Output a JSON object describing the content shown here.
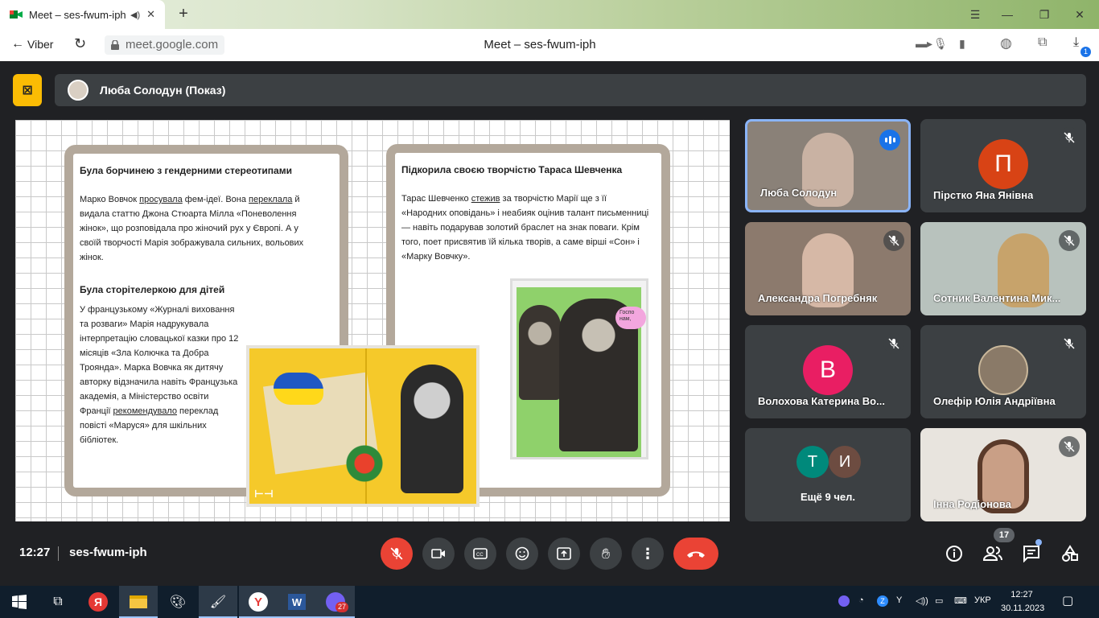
{
  "browser": {
    "tab_title": "Meet – ses-fwum-iph",
    "back_label": "Viber",
    "url": "meet.google.com",
    "page_title": "Meet – ses-fwum-iph",
    "download_badge": "1"
  },
  "meet": {
    "presenter_label": "Люба Солодун (Показ)",
    "time": "12:27",
    "meeting_code": "ses-fwum-iph",
    "participants_count": "17"
  },
  "slide": {
    "card1": {
      "heading1": "Була борчинею з гендерними стереотипами",
      "para1_parts": [
        "Марко Вовчок ",
        "просувала",
        " фем-ідеї. Вона ",
        "переклала",
        " й видала статтю Джона Стюарта Мілла «Поневолення жінок», що розповідала про жіночий рух у Європі. А у своїй творчості Марія зображувала сильних, вольових жінок."
      ],
      "heading2": "Була сторітелеркою для дітей",
      "para2_parts": [
        "У французькому «Журналі виховання та розваги» Марія надрукувала інтерпретацію словацької казки про 12 місяців «Зла Колючка та Добра Троянда». Марка Вовчка як дитячу авторку відзначила навіть Французька академія, а Міністерство освіти Франції ",
        "рекомендувало",
        " переклад повісті «Маруся» для шкільних бібліотек."
      ]
    },
    "card2": {
      "heading": "Підкорила своєю творчістю Тараса Шевченка",
      "para_parts": [
        "Тарас Шевченко ",
        "стежив",
        " за творчістю Марії ще з її «Народних оповідань» і неабияк оцінив талант письменниці — навіть подарував золотий браслет на знак поваги. Крім того, поет присвятив їй кілька творів, а саме вірші «Сон» і «Марку Вовчку»."
      ]
    },
    "poster_bubble": "Госпо нам,"
  },
  "tiles": [
    {
      "name": "Люба Солодун",
      "type": "video",
      "speaking": true
    },
    {
      "name": "Пірстко Яна Янівна",
      "type": "avatar",
      "initial": "П",
      "color": "#d84315"
    },
    {
      "name": "Александра Погребняк",
      "type": "video"
    },
    {
      "name": "Сотник Валентина Мик...",
      "type": "video"
    },
    {
      "name": "Волохова Катерина Во...",
      "type": "avatar",
      "initial": "В",
      "color": "#e91e63"
    },
    {
      "name": "Олефір Юлія Андріївна",
      "type": "photo"
    },
    {
      "name": "Ещё 9 чел.",
      "type": "more",
      "initials": [
        "Т",
        "И"
      ],
      "colors": [
        "#00897b",
        "#6d4c41"
      ]
    },
    {
      "name": "Інна Родіонова",
      "type": "video"
    }
  ],
  "taskbar": {
    "viber_badge": "27",
    "lang": "УКР",
    "time": "12:27",
    "date": "30.11.2023"
  }
}
